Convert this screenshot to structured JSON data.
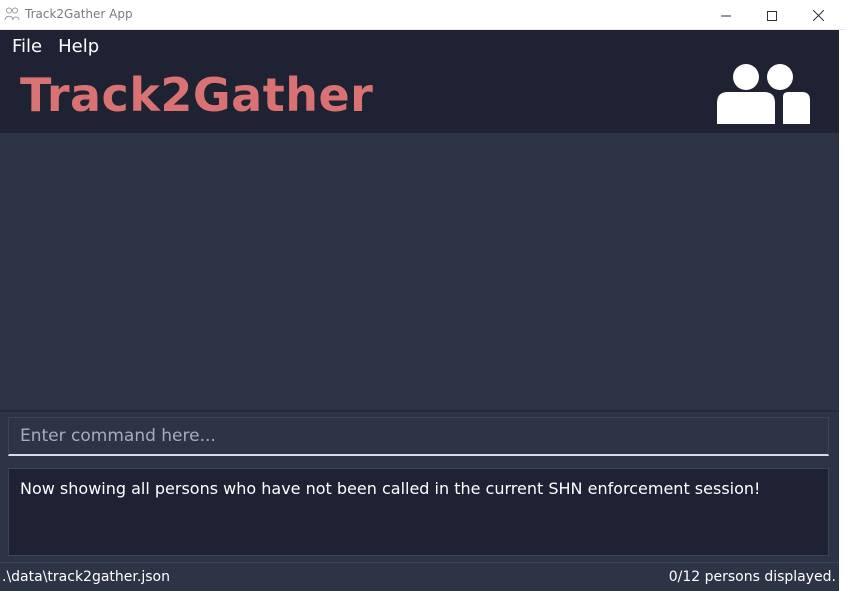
{
  "window": {
    "title": "Track2Gather App",
    "icon": "people-outline-icon",
    "controls": [
      "minimize-icon",
      "maximize-icon",
      "close-icon"
    ]
  },
  "menu": {
    "items": [
      {
        "label": "File"
      },
      {
        "label": "Help"
      }
    ]
  },
  "header": {
    "brand": "Track2Gather",
    "brand_color": "#d97373",
    "icon": "people-icon"
  },
  "person_list": {
    "items": []
  },
  "command": {
    "placeholder": "Enter command here...",
    "value": ""
  },
  "result": {
    "message": "Now showing all persons who have not been called in the current SHN enforcement session!"
  },
  "status": {
    "file_path": ".\\data\\track2gather.json",
    "count_text": "0/12 persons displayed."
  },
  "colors": {
    "header_bg": "#1e2233",
    "panel_bg": "#2c3446",
    "text": "#ffffff"
  }
}
